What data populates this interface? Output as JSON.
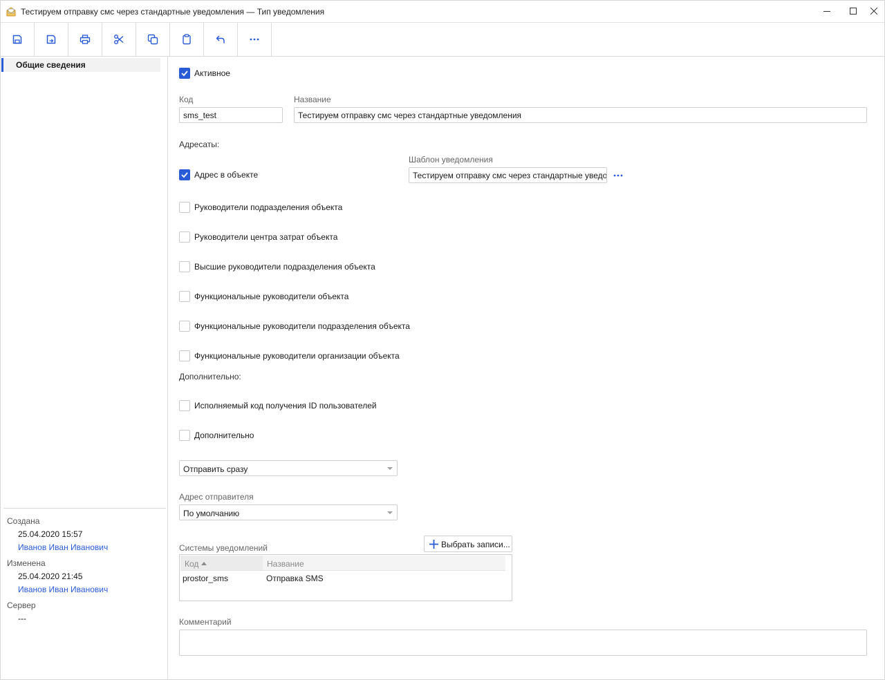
{
  "window": {
    "title": "Тестируем отправку смс через стандартные уведомления — Тип уведомления"
  },
  "toolbar": {
    "buttons": [
      {
        "icon": "save-icon"
      },
      {
        "icon": "save-close-icon"
      },
      {
        "icon": "print-icon"
      },
      {
        "icon": "cut-icon"
      },
      {
        "icon": "copy-icon"
      },
      {
        "icon": "paste-icon"
      },
      {
        "icon": "undo-icon"
      },
      {
        "icon": "more-icon"
      }
    ]
  },
  "sidebar": {
    "items": [
      {
        "label": "Общие сведения"
      }
    ],
    "meta": {
      "created_label": "Создана",
      "created_date": "25.04.2020 15:57",
      "created_by": "Иванов Иван Иванович",
      "modified_label": "Изменена",
      "modified_date": "25.04.2020 21:45",
      "modified_by": "Иванов Иван Иванович",
      "server_label": "Сервер",
      "server_value": "---"
    }
  },
  "form": {
    "active": {
      "label": "Активное",
      "checked": true
    },
    "code": {
      "label": "Код",
      "value": "sms_test"
    },
    "name": {
      "label": "Название",
      "value": "Тестируем отправку смс через стандартные уведомления"
    },
    "recipients_label": "Адресаты:",
    "template": {
      "label": "Шаблон уведомления",
      "value": "Тестируем отправку смс через стандартные уведо"
    },
    "recipients": [
      {
        "label": "Адрес в объекте",
        "checked": true
      },
      {
        "label": "Руководители подразделения объекта",
        "checked": false
      },
      {
        "label": "Руководители центра затрат объекта",
        "checked": false
      },
      {
        "label": "Высшие руководители подразделения объекта",
        "checked": false
      },
      {
        "label": "Функциональные руководители объекта",
        "checked": false
      },
      {
        "label": "Функциональные руководители подразделения объекта",
        "checked": false
      },
      {
        "label": "Функциональные руководители организации объекта",
        "checked": false
      }
    ],
    "additional_label": "Дополнительно:",
    "additional": [
      {
        "label": "Исполняемый код получения ID пользователей",
        "checked": false
      },
      {
        "label": "Дополнительно",
        "checked": false
      }
    ],
    "send_mode": {
      "value": "Отправить сразу"
    },
    "sender": {
      "label": "Адрес отправителя",
      "value": "По умолчанию"
    },
    "systems": {
      "label": "Системы уведомлений",
      "select_button": "Выбрать записи...",
      "columns": [
        "Код",
        "Название"
      ],
      "rows": [
        [
          "prostor_sms",
          "Отправка SMS"
        ]
      ]
    },
    "comment": {
      "label": "Комментарий",
      "value": ""
    }
  },
  "colors": {
    "accent": "#2a5bd7",
    "border": "#cfcfcf",
    "label": "#666666"
  }
}
